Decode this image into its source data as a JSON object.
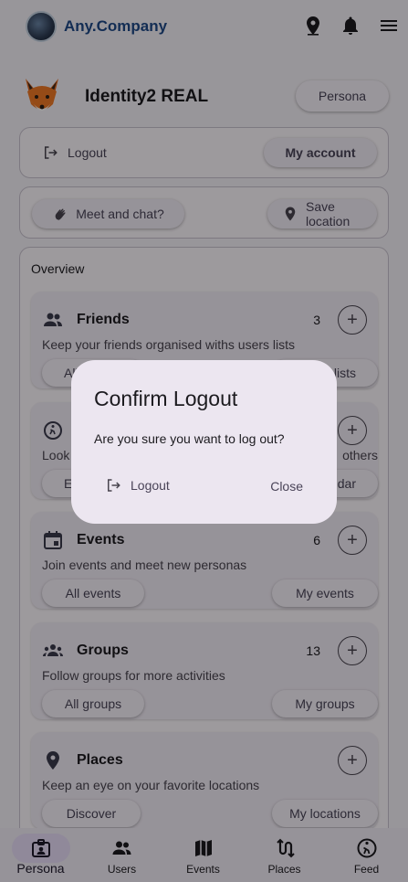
{
  "appbar": {
    "brand": "Any.Company",
    "icons": [
      "map-pin-icon",
      "bell-icon",
      "menu-icon"
    ]
  },
  "profile": {
    "name": "Identity2 REAL",
    "persona_button": "Persona"
  },
  "account_card": {
    "logout_label": "Logout",
    "my_account_label": "My account"
  },
  "actions_card": {
    "meet_label": "Meet and chat?",
    "save_location_label": "Save\nlocation"
  },
  "overview": {
    "title": "Overview",
    "sections": [
      {
        "title": "Friends",
        "count": "3",
        "description": "Keep your friends organised withs users lists",
        "left_button": "All",
        "right_button": "lists"
      },
      {
        "title": "",
        "count": "",
        "description": "Look",
        "description_right": "others",
        "left_button": "E",
        "right_button": "dar"
      },
      {
        "title": "Events",
        "count": "6",
        "description": "Join events and meet new personas",
        "left_button": "All events",
        "right_button": "My events"
      },
      {
        "title": "Groups",
        "count": "13",
        "description": "Follow groups for more activities",
        "left_button": "All groups",
        "right_button": "My groups"
      },
      {
        "title": "Places",
        "count": "",
        "description": "Keep an eye on your favorite locations",
        "left_button": "Discover",
        "right_button": "My locations"
      }
    ]
  },
  "bottom_nav": {
    "items": [
      {
        "label": "Persona",
        "icon": "badge-icon",
        "active": true
      },
      {
        "label": "Users",
        "icon": "people-icon",
        "active": false
      },
      {
        "label": "Events",
        "icon": "map-icon",
        "active": false
      },
      {
        "label": "Places",
        "icon": "route-icon",
        "active": false
      },
      {
        "label": "Feed",
        "icon": "explore-icon",
        "active": false
      }
    ]
  },
  "dialog": {
    "title": "Confirm Logout",
    "message": "Are you sure you want to log out?",
    "logout_label": "Logout",
    "close_label": "Close"
  },
  "colors": {
    "brand": "#1f4a88",
    "surface": "#f6f2f8",
    "dialog": "#ece6f0",
    "nav_active": "#e8def8"
  }
}
